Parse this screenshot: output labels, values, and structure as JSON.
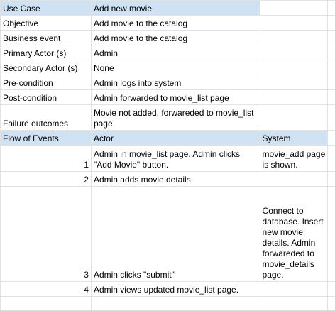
{
  "colors": {
    "header_fill": "#cfe2f3",
    "grid_line": "#e2e2e2",
    "text": "#000000"
  },
  "use_case": {
    "label": "Use Case",
    "value": "Add new movie"
  },
  "rows": {
    "objective": {
      "label": "Objective",
      "value": "Add movie to the catalog"
    },
    "business_event": {
      "label": "Business event",
      "value": "Add movie to the catalog"
    },
    "primary_actor": {
      "label": "Primary Actor (s)",
      "value": "Admin"
    },
    "secondary_actor": {
      "label": "Secondary Actor (s)",
      "value": "None"
    },
    "precondition": {
      "label": "Pre-condition",
      "value": "Admin logs into system"
    },
    "postcondition": {
      "label": "Post-condition",
      "value": "Admin forwarded to movie_list page"
    },
    "failure": {
      "label": "Failure outcomes",
      "value": "Movie not added, forwareded to movie_list page"
    }
  },
  "flow": {
    "header": {
      "label": "Flow of Events",
      "actor": "Actor",
      "system": "System"
    },
    "steps": [
      {
        "num": "1",
        "actor": "Admin in movie_list page. Admin clicks \"Add Movie\" button.",
        "system": "movie_add page is shown."
      },
      {
        "num": "2",
        "actor": "Admin adds movie details",
        "system": ""
      },
      {
        "num": "3",
        "actor": "Admin clicks \"submit\"",
        "system": "Connect to database. Insert new movie details. Admin forwareded to movie_details page."
      },
      {
        "num": "4",
        "actor": "Admin views updated movie_list page.",
        "system": ""
      }
    ]
  }
}
